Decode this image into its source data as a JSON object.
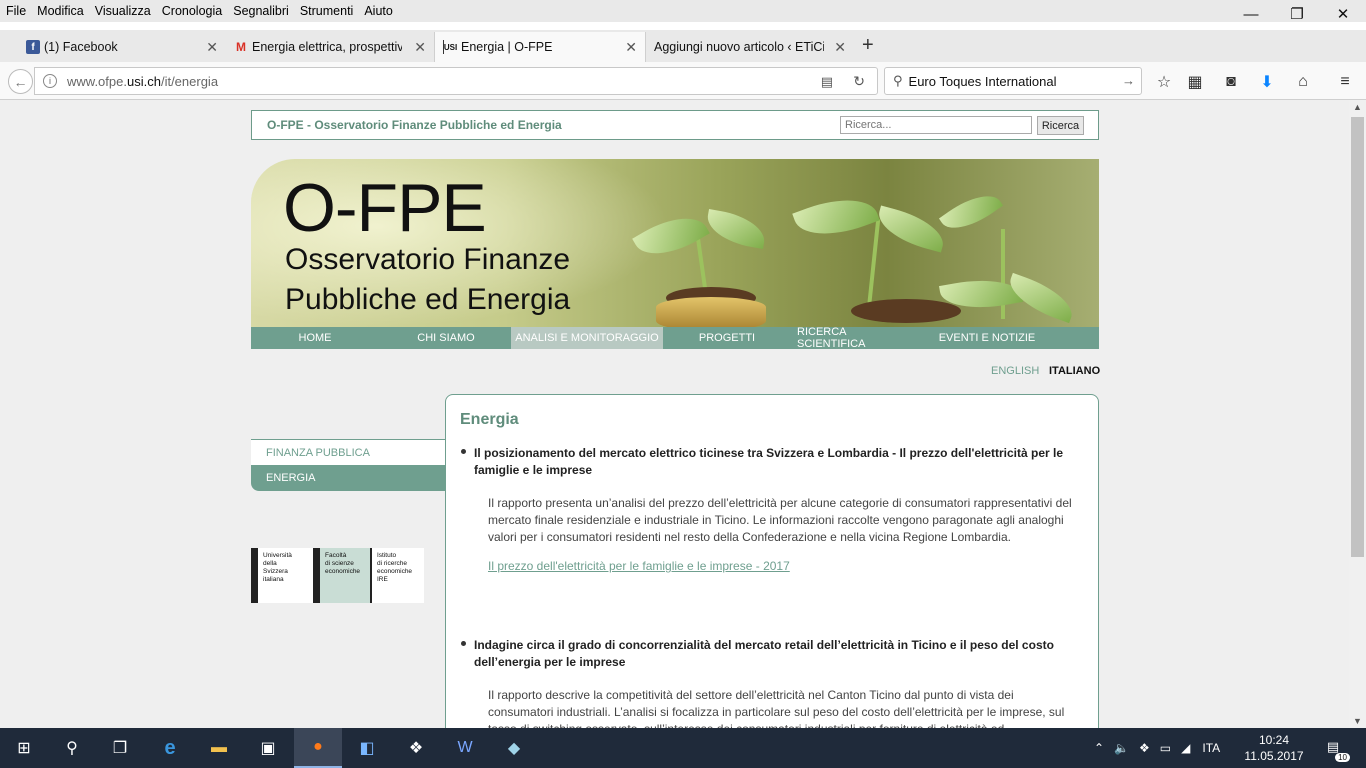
{
  "menubar": {
    "items": [
      "File",
      "Modifica",
      "Visualizza",
      "Cronologia",
      "Segnalibri",
      "Strumenti",
      "Aiuto"
    ]
  },
  "window_controls": {
    "minimize": "—",
    "restore": "❐",
    "close": "✕"
  },
  "tabs": [
    {
      "title": "(1) Facebook",
      "icon": "facebook-icon"
    },
    {
      "title": "Energia elettrica, prospettive",
      "icon": "gmail-icon"
    },
    {
      "title": "Energia | O-FPE",
      "icon": "usi-icon"
    },
    {
      "title": "Aggiungi nuovo articolo ‹ ETiCin",
      "icon": ""
    }
  ],
  "address_bar": {
    "url_prefix": "www.ofpe.",
    "url_domain": "usi.ch",
    "url_suffix": "/it/energia"
  },
  "search_bar": {
    "value": "Euro Toques International"
  },
  "site": {
    "header_title": "O-FPE - Osservatorio Finanze Pubbliche ed Energia",
    "search_placeholder": "Ricerca...",
    "search_button": "Ricerca",
    "banner_title": "O-FPE",
    "banner_sub1": "Osservatorio Finanze",
    "banner_sub2": "Pubbliche ed Energia"
  },
  "nav": {
    "items": [
      "HOME",
      "CHI SIAMO",
      "ANALISI E MONITORAGGIO",
      "PROGETTI",
      "RICERCA SCIENTIFICA",
      "EVENTI E NOTIZIE"
    ],
    "active": "ANALISI E MONITORAGGIO"
  },
  "language": {
    "english": "ENGLISH",
    "italiano": "ITALIANO"
  },
  "sidebar": {
    "items": [
      "FINANZA PUBBLICA",
      "ENERGIA"
    ]
  },
  "logos": {
    "col1": "Università\ndella\nSvizzera\nitaliana",
    "col2": "Facoltà\ndi scienze\neconomiche",
    "col3": "Istituto\ndi ricerche\neconomiche\nIRE"
  },
  "content": {
    "heading": "Energia",
    "items": [
      {
        "title": "Il posizionamento del mercato elettrico ticinese tra Svizzera e Lombardia - Il prezzo dell'elettricità per le famiglie e le imprese",
        "desc": "Il rapporto presenta un’analisi del prezzo dell’elettricità per alcune categorie di consumatori rappresentativi del mercato finale residenziale e industriale in Ticino. Le informazioni raccolte vengono paragonate agli analoghi valori per i consumatori residenti nel resto della Confederazione e nella vicina Regione Lombardia.",
        "link": "Il prezzo dell'elettricità per le famiglie e le imprese - 2017"
      },
      {
        "title": "Indagine circa il grado di concorrenzialità del mercato retail dell’elettricità in Ticino e il peso del costo dell’energia per le imprese",
        "desc": "Il rapporto descrive la competitività del settore dell’elettricità nel Canton Ticino dal punto di vista dei consumatori industriali. L’analisi si focalizza in particolare sul peso del costo dell’elettricità per le imprese, sul tasso di switching osservato, sull’interesse dei consumatori industriali per forniture di elettricità ed"
      }
    ]
  },
  "taskbar": {
    "language": "ITA",
    "time": "10:24",
    "date": "11.05.2017",
    "notifications": "10"
  }
}
